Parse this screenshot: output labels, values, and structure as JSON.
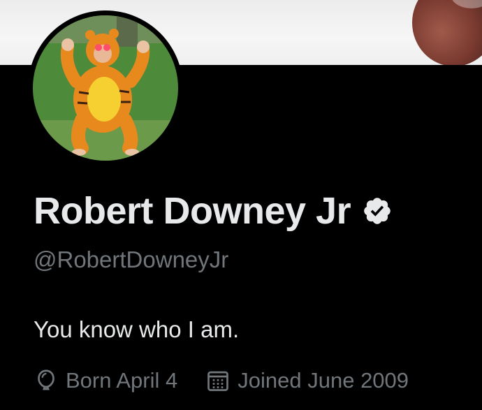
{
  "profile": {
    "display_name": "Robert Downey Jr",
    "handle": "@RobertDowneyJr",
    "bio": "You know who I am.",
    "verified": true
  },
  "meta": {
    "born": {
      "icon": "balloon-icon",
      "label": "Born April 4"
    },
    "joined": {
      "icon": "calendar-icon",
      "label": "Joined June 2009"
    }
  },
  "colors": {
    "background": "#000000",
    "primary_text": "#e7e9ea",
    "secondary_text": "#71767b",
    "verified_badge": "#e7e9ea"
  }
}
